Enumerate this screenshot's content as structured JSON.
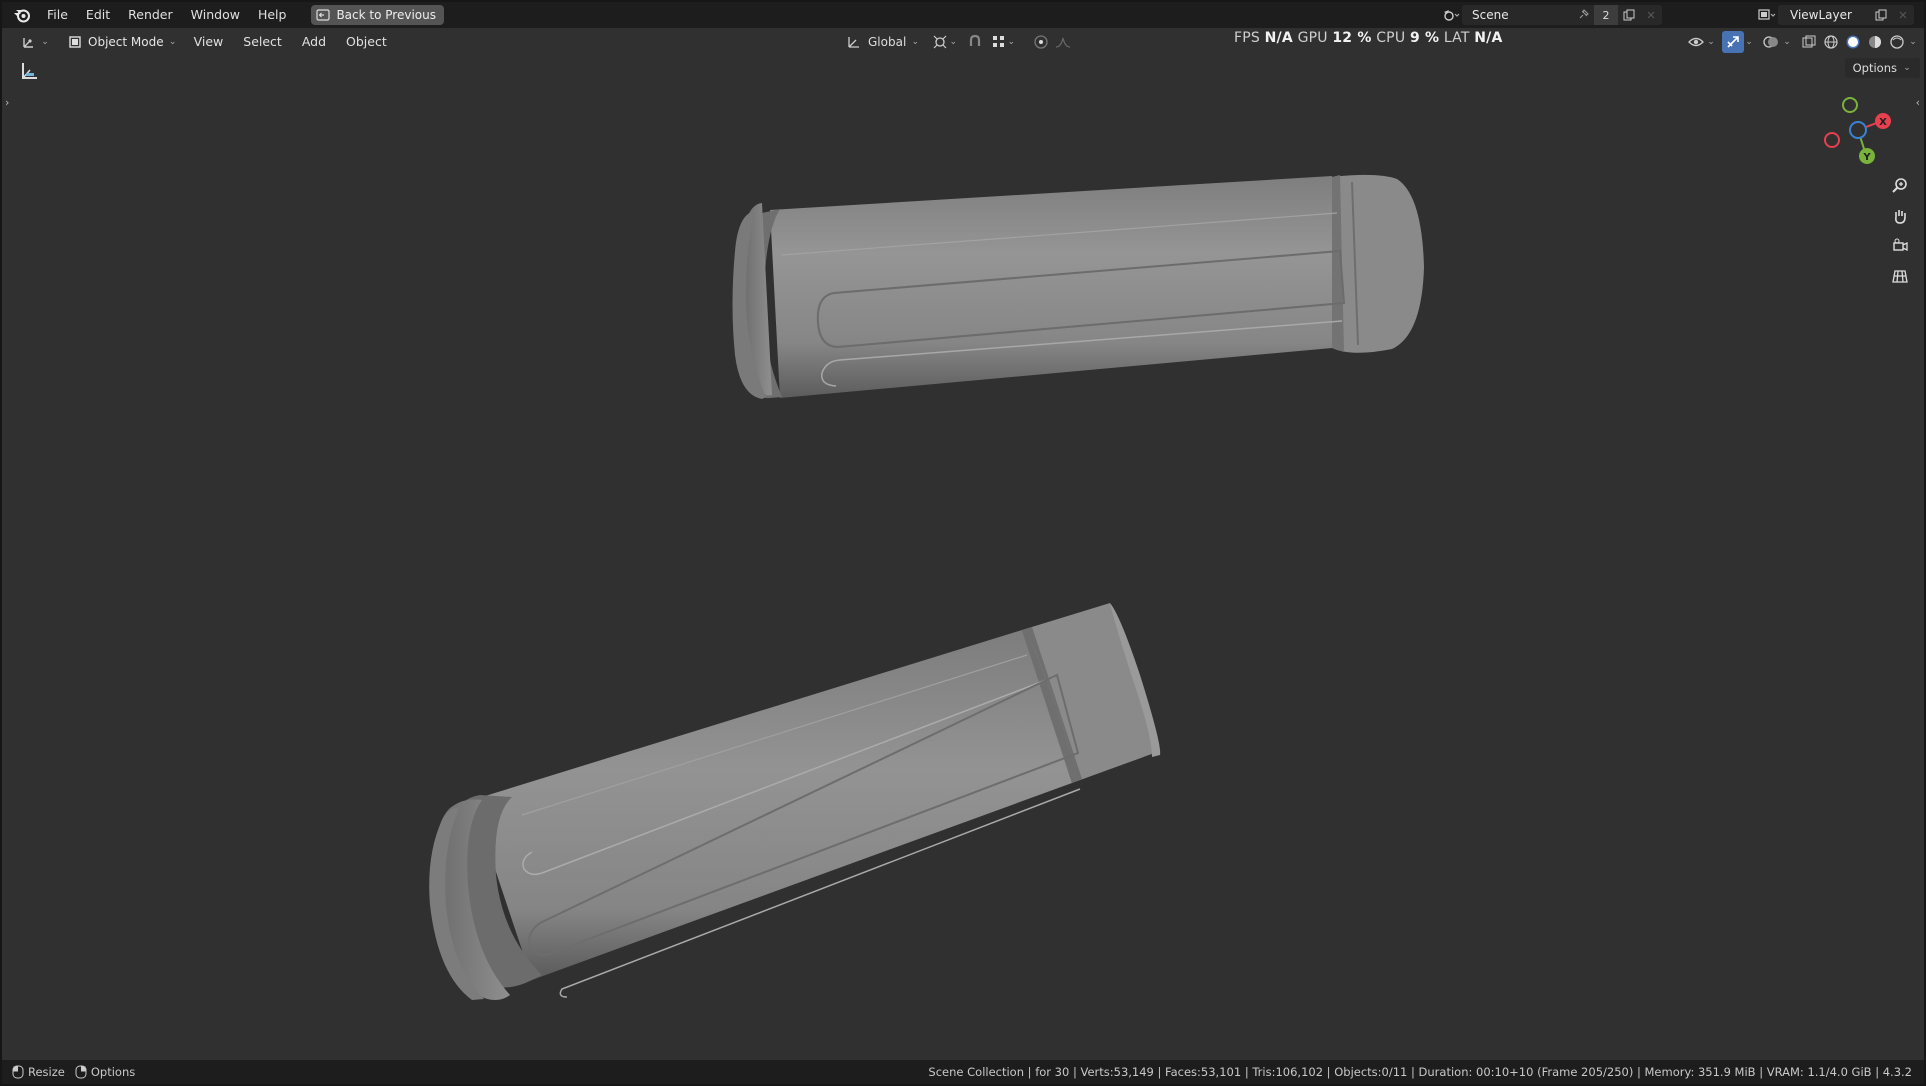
{
  "topbar": {
    "menus": [
      "File",
      "Edit",
      "Render",
      "Window",
      "Help"
    ],
    "back_button": "Back to Previous",
    "scene_name": "Scene",
    "scene_users": "2",
    "view_layer": "ViewLayer"
  },
  "header": {
    "mode": "Object Mode",
    "menus": [
      "View",
      "Select",
      "Add",
      "Object"
    ],
    "orientation": "Global",
    "options_label": "Options"
  },
  "stats": {
    "fps_label": "FPS",
    "fps_value": "N/A",
    "gpu_label": "GPU",
    "gpu_value": "12 %",
    "cpu_label": "CPU",
    "cpu_value": "9 %",
    "lat_label": "LAT",
    "lat_value": "N/A"
  },
  "gizmo": {
    "x_label": "X",
    "y_label": "Y"
  },
  "statusbar": {
    "left": [
      "Resize",
      "Options"
    ],
    "right": "Scene Collection | for 30 | Verts:53,149 | Faces:53,101 | Tris:106,102 | Objects:0/11 | Duration: 00:10+10 (Frame 205/250) | Memory: 351.9 MiB | VRAM: 1.1/4.0 GiB | 4.3.2"
  },
  "colors": {
    "x_axis": "#e8404f",
    "y_axis": "#79b33c",
    "z_axis": "#3a83d4",
    "active_blue": "#4772b3"
  }
}
